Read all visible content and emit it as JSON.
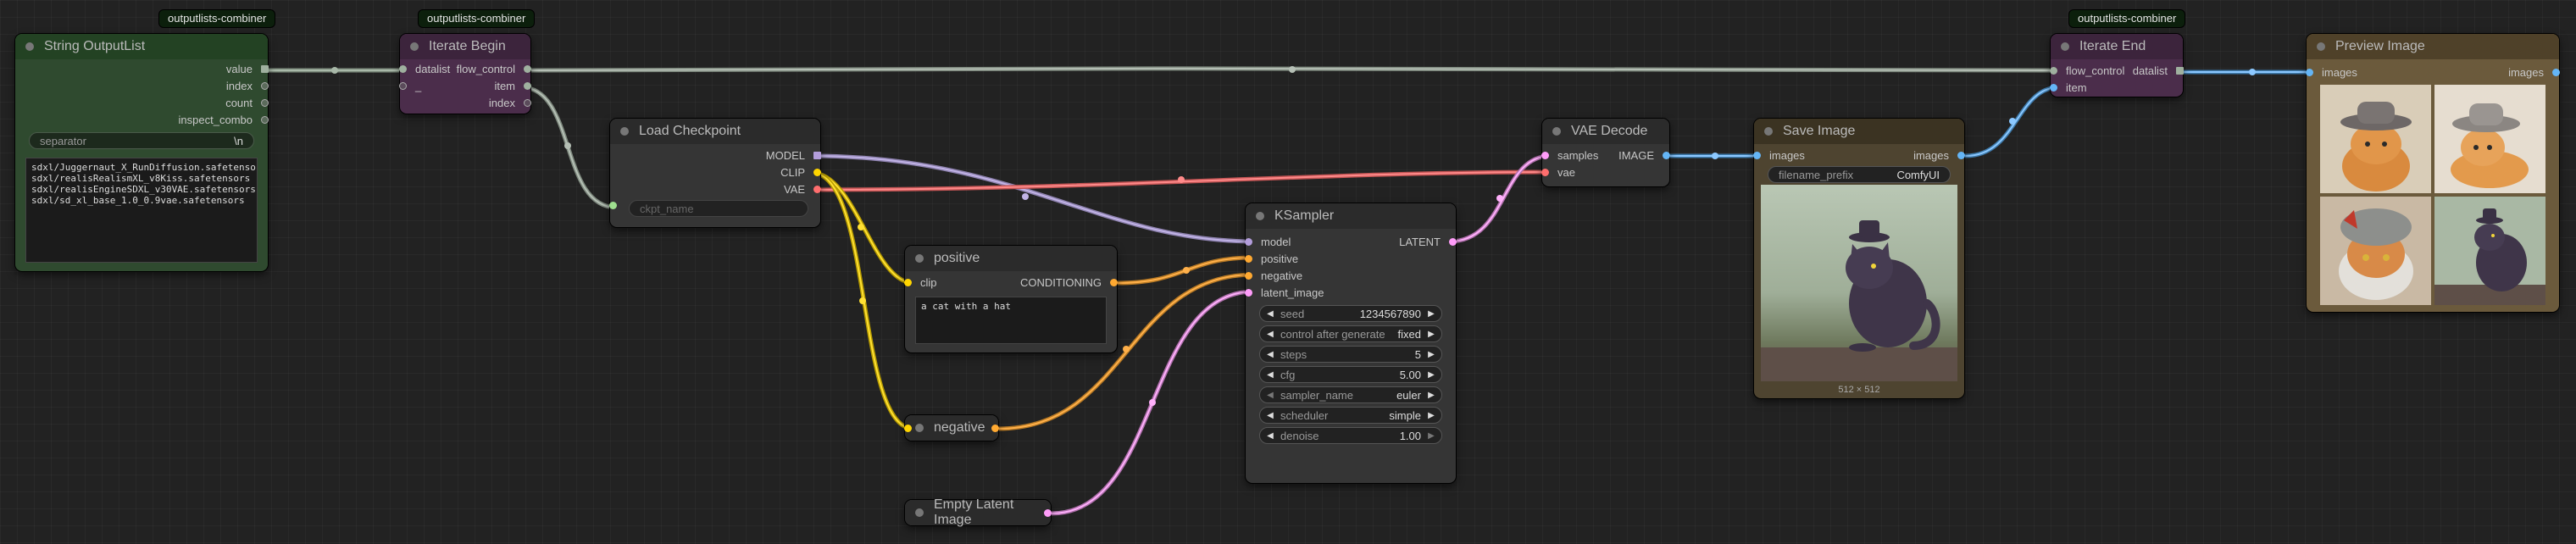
{
  "colors": {
    "string_wire": "#9fb09f",
    "model_wire": "#b39ddb",
    "clip_wire": "#ffd500",
    "vae_wire": "#ff6e6e",
    "conditioning_wire": "#ffa931",
    "latent_wire": "#ff9cf9",
    "image_wire": "#64b5f6",
    "flow_wire": "#9aa59a"
  },
  "nodes": {
    "string_outputlist": {
      "title": "String OutputList",
      "badge": "outputlists-combiner",
      "outputs": [
        "value",
        "index",
        "count",
        "inspect_combo"
      ],
      "separator_label": "separator",
      "separator_value": "\\n",
      "text": "sdxl/Juggernaut_X_RunDiffusion.safetensors\nsdxl/realisRealismXL_v8Kiss.safetensors\nsdxl/realisEngineSDXL_v30VAE.safetensors\nsdxl/sd_xl_base_1.0_0.9vae.safetensors"
    },
    "iterate_begin": {
      "title": "Iterate Begin",
      "badge": "outputlists-combiner",
      "inputs": [
        "datalist",
        "_"
      ],
      "outputs": [
        "flow_control",
        "item",
        "index"
      ]
    },
    "load_checkpoint": {
      "title": "Load Checkpoint",
      "outputs": [
        "MODEL",
        "CLIP",
        "VAE"
      ],
      "ckpt_placeholder": "ckpt_name"
    },
    "positive": {
      "title": "positive",
      "input": "clip",
      "output": "CONDITIONING",
      "text": "a cat with a hat"
    },
    "negative": {
      "title": "negative"
    },
    "empty_latent": {
      "title": "Empty Latent Image"
    },
    "ksampler": {
      "title": "KSampler",
      "inputs": [
        "model",
        "positive",
        "negative",
        "latent_image"
      ],
      "output": "LATENT",
      "widgets": [
        {
          "label": "seed",
          "value": "1234567890"
        },
        {
          "label": "control after generate",
          "value": "fixed"
        },
        {
          "label": "steps",
          "value": "5"
        },
        {
          "label": "cfg",
          "value": "5.00"
        },
        {
          "label": "sampler_name",
          "value": "euler"
        },
        {
          "label": "scheduler",
          "value": "simple"
        },
        {
          "label": "denoise",
          "value": "1.00"
        }
      ]
    },
    "vae_decode": {
      "title": "VAE Decode",
      "inputs": [
        "samples",
        "vae"
      ],
      "output": "IMAGE"
    },
    "save_image": {
      "title": "Save Image",
      "input": "images",
      "output": "images",
      "prefix_label": "filename_prefix",
      "prefix_value": "ComfyUI",
      "size_label": "512 × 512"
    },
    "iterate_end": {
      "title": "Iterate End",
      "badge": "outputlists-combiner",
      "inputs": [
        "flow_control",
        "item"
      ],
      "output": "datalist"
    },
    "preview_image": {
      "title": "Preview Image",
      "input": "images",
      "output": "images"
    }
  }
}
